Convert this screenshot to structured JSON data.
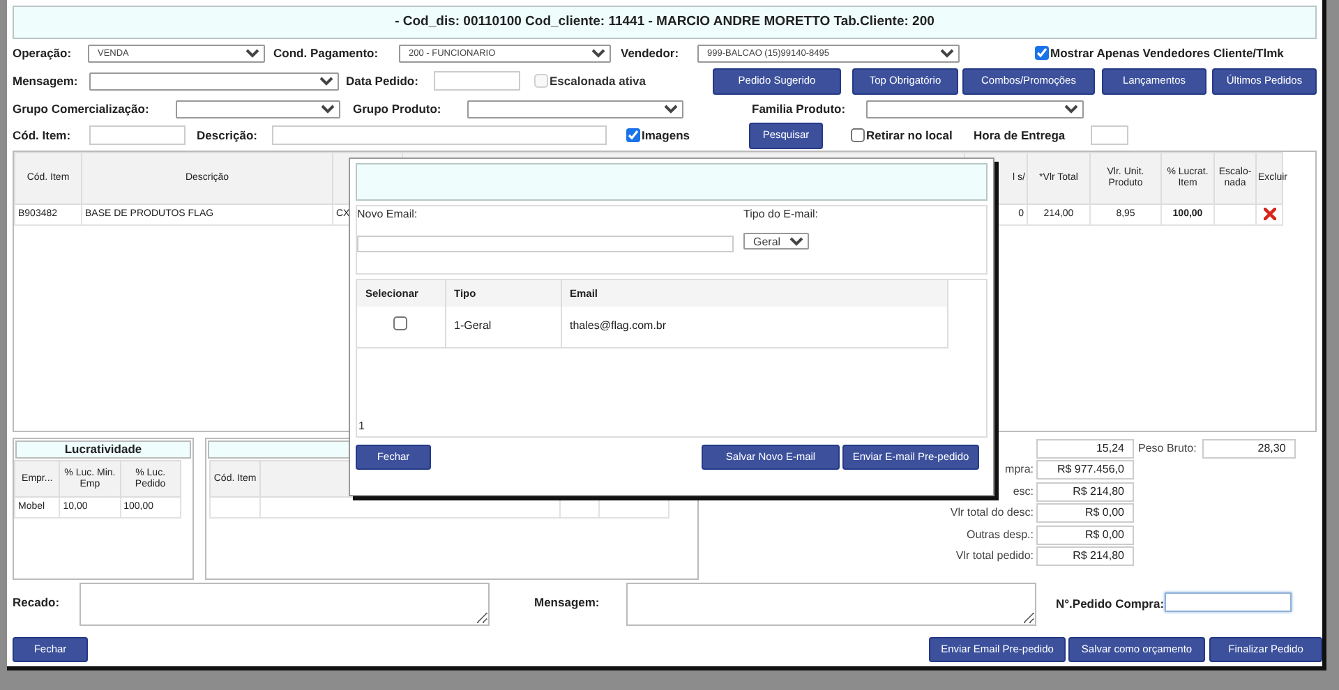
{
  "header": {
    "title": "- Cod_dis: 00110100 Cod_cliente: 11441 - MARCIO ANDRE MORETTO Tab.Cliente: 200"
  },
  "form_rows": [
    [
      {
        "kind": "label",
        "text": "Operação:"
      },
      {
        "kind": "select",
        "value": "VENDA"
      },
      {
        "kind": "label",
        "text": "Cond. Pagamento:"
      },
      {
        "kind": "select",
        "value": "200 - FUNCIONARIO"
      },
      {
        "kind": "label",
        "text": "Vendedor:"
      },
      {
        "kind": "select",
        "value": "999-BALCAO (15)99140-8495"
      },
      {
        "kind": "checkbox",
        "label": "Mostrar Apenas Vendedores Cliente/Tlmk",
        "checked": true,
        "disabled": false
      }
    ],
    [
      {
        "kind": "label",
        "text": "Mensagem:"
      },
      {
        "kind": "select"
      },
      {
        "kind": "label",
        "text": "Data Pedido:"
      },
      {
        "kind": "input"
      },
      {
        "kind": "checkbox",
        "label": "Escalonada ativa",
        "checked": false,
        "disabled": true
      },
      {
        "kind": "button",
        "label": "Pedido Sugerido"
      },
      {
        "kind": "button",
        "label": "Top Obrigatório"
      },
      {
        "kind": "button",
        "label": "Combos/Promoções"
      },
      {
        "kind": "button",
        "label": "Lançamentos"
      },
      {
        "kind": "button",
        "label": "Últimos Pedidos"
      }
    ],
    [
      {
        "kind": "label",
        "text": "Grupo Comercialização:"
      },
      {
        "kind": "select"
      },
      {
        "kind": "label",
        "text": "Grupo Produto:"
      },
      {
        "kind": "select"
      },
      {
        "kind": "label",
        "text": "Familia Produto:"
      },
      {
        "kind": "select"
      }
    ],
    [
      {
        "kind": "label",
        "text": "Cód. Item:"
      },
      {
        "kind": "input"
      },
      {
        "kind": "label",
        "text": "Descrição:"
      },
      {
        "kind": "input"
      },
      {
        "kind": "checkbox",
        "label": "Imagens",
        "checked": true,
        "disabled": false
      },
      {
        "kind": "button",
        "label": "Pesquisar"
      },
      {
        "kind": "checkbox",
        "label": "Retirar no local",
        "checked": false,
        "disabled": false
      },
      {
        "kind": "label",
        "text": "Hora de Entrega"
      },
      {
        "kind": "input"
      }
    ]
  ],
  "items_table": {
    "columns": [
      "Cód. Item",
      "Descrição",
      "l s/",
      "*Vlr Total",
      "Vlr. Unit. Produto",
      "% Lucrat. Item",
      "Escalo-nada",
      "Excluir"
    ],
    "rows": [
      {
        "cod_item": "B903482",
        "descricao": "BASE DE PRODUTOS FLAG",
        "column_3": "CX",
        "column_4": "0",
        "vlr_total": "214,00",
        "vlr_unit": "8,95",
        "lucrat": "100,00"
      }
    ]
  },
  "lucratividade": {
    "title": "Lucratividade",
    "columns": [
      "Empr...",
      "% Luc. Min. Emp",
      "% Luc. Pedido"
    ],
    "rows": [
      [
        "Mobel",
        "10,00",
        "100,00"
      ]
    ]
  },
  "second_panel": {
    "columns": [
      "Cód. Item"
    ]
  },
  "totals": [
    {
      "value": "15,24"
    },
    {
      "label": "mpra:",
      "value": "R$ 977.456,0"
    },
    {
      "label": "esc:",
      "value": "R$ 214,80"
    },
    {
      "label": "Vlr total do desc:",
      "value": "R$ 0,00"
    },
    {
      "label": "Outras desp.:",
      "value": "R$ 0,00"
    },
    {
      "label": "Vlr total pedido:",
      "value": "R$ 214,80"
    }
  ],
  "peso_bruto": {
    "label": "Peso Bruto:",
    "value": "28,30"
  },
  "notes": {
    "recado_label": "Recado:",
    "mensagem_label": "Mensagem:",
    "pedido_compra_label": "N°.Pedido Compra:"
  },
  "footer_buttons": [
    "Fechar",
    "Enviar Email Pre-pedido",
    "Salvar como orçamento",
    "Finalizar Pedido"
  ],
  "email_modal": {
    "novo_email_label": "Novo Email:",
    "tipo_label": "Tipo do E-mail:",
    "tipo_value": "Geral",
    "columns": [
      "Selecionar",
      "Tipo",
      "Email"
    ],
    "rows": [
      {
        "checked": false,
        "tipo": "1-Geral",
        "email": "thales@flag.com.br"
      }
    ],
    "pager": "1",
    "buttons": [
      "Fechar",
      "Salvar Novo E-mail",
      "Enviar E-mail Pre-pedido"
    ]
  }
}
